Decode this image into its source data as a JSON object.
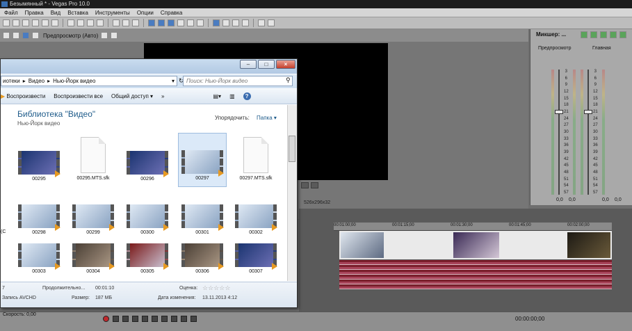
{
  "window_title": "Безымянный * - Vegas Pro 10.0",
  "menu": [
    "Файл",
    "Правка",
    "Вид",
    "Вставка",
    "Инструменты",
    "Опции",
    "Справка"
  ],
  "preview": {
    "label": "Предпросмотр (Авто)",
    "info": "526x296x32"
  },
  "mixer": {
    "title": "Микшер: ...",
    "preview_label": "Предпросмотр",
    "main_label": "Главная",
    "scale": [
      "3",
      "6",
      "9",
      "12",
      "15",
      "18",
      "21",
      "24",
      "27",
      "30",
      "33",
      "36",
      "39",
      "42",
      "45",
      "48",
      "51",
      "54",
      "57"
    ],
    "values": [
      "0,0",
      "0,0",
      "0,0",
      "0,0"
    ]
  },
  "timeline": {
    "ruler": [
      "00:01:00;00",
      "00:01:15;00",
      "00:01:30;00",
      "00:01:45;00",
      "00:02:00;00"
    ]
  },
  "transport": {
    "speed_label": "Скорость: 0,00",
    "timecode": "00:00:00;00"
  },
  "explorer": {
    "breadcrumb": [
      "иотеки",
      "Видео",
      "Нью-Йорк видео"
    ],
    "search_placeholder": "Поиск: Нью-Йорк видео",
    "commands": [
      "Воспроизвести",
      "Воспроизвести все",
      "Общий доступ",
      "»"
    ],
    "library_title": "Библиотека \"Видео\"",
    "library_subtitle": "Нью-Йорк видео",
    "arrange_label": "Упорядочить:",
    "arrange_value": "Папка",
    "items_row1": [
      "00295",
      "00295.MTS.sfk",
      "00296",
      "00297",
      "00297.MTS.sfk"
    ],
    "items_row2": [
      "00298",
      "00299",
      "00300",
      "00301",
      "00302"
    ],
    "items_row3": [
      "00303",
      "00304",
      "00305",
      "00306",
      "00307"
    ],
    "side_label": "(С",
    "details": {
      "name_partial": "7",
      "type": "Запись AVCHD",
      "duration_label": "Продолжительно...",
      "duration_value": "00:01:10",
      "size_label": "Размер:",
      "size_value": "187 МБ",
      "rating_label": "Оценка:",
      "modified_label": "Дата изменения:",
      "modified_value": "13.11.2013 4:12"
    }
  }
}
